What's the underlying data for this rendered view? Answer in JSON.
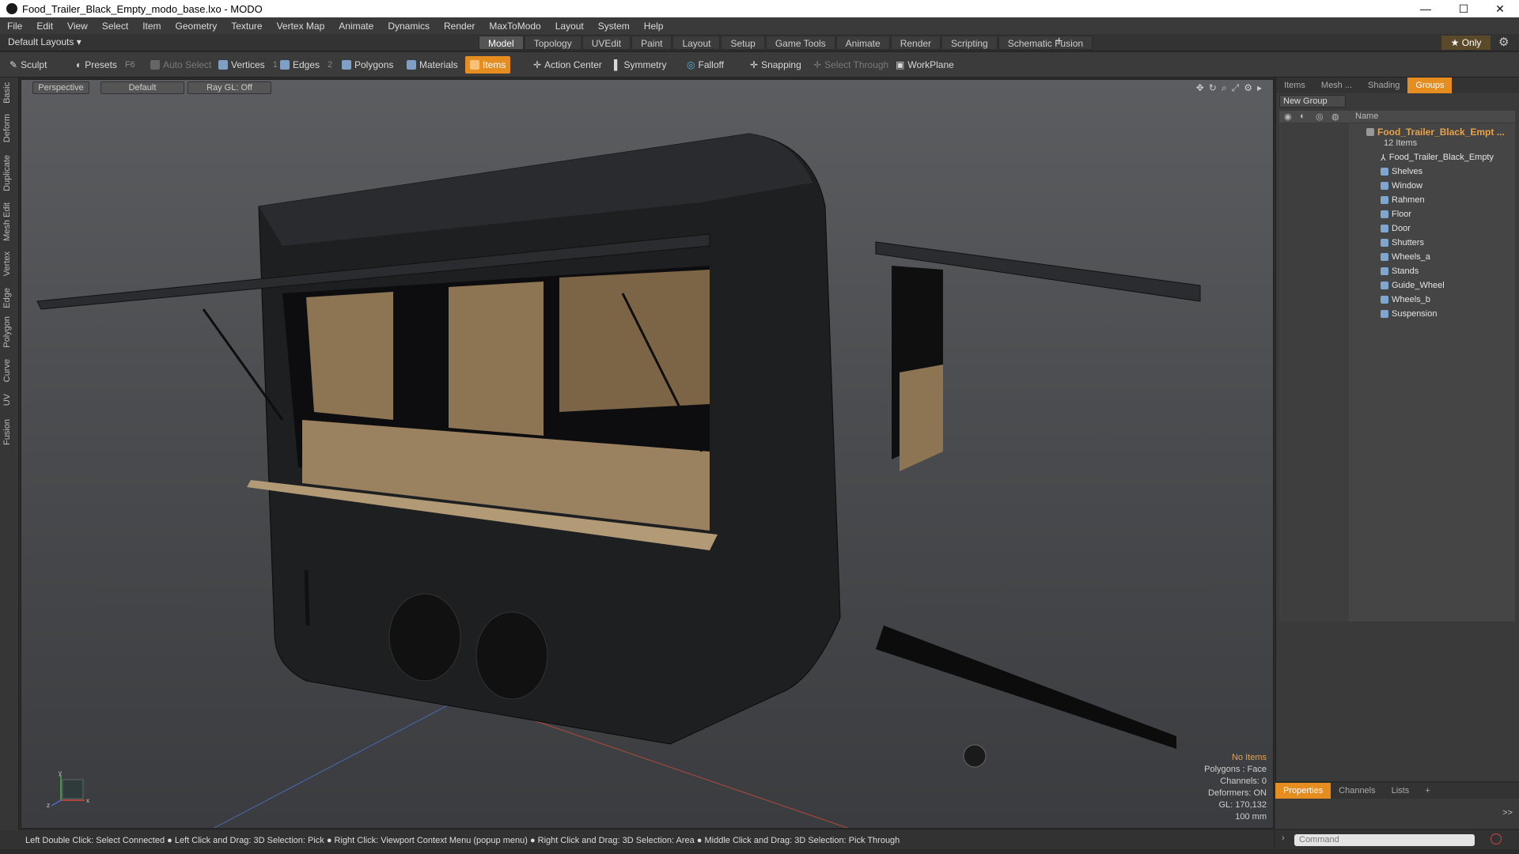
{
  "window": {
    "title": "Food_Trailer_Black_Empty_modo_base.lxo - MODO",
    "min": "—",
    "max": "☐",
    "close": "✕"
  },
  "menu": [
    "File",
    "Edit",
    "View",
    "Select",
    "Item",
    "Geometry",
    "Texture",
    "Vertex Map",
    "Animate",
    "Dynamics",
    "Render",
    "MaxToModo",
    "Layout",
    "System",
    "Help"
  ],
  "layouts": {
    "selector": "Default Layouts ▾",
    "tabs": [
      "Model",
      "Topology",
      "UVEdit",
      "Paint",
      "Layout",
      "Setup",
      "Game Tools",
      "Animate",
      "Render",
      "Scripting",
      "Schematic Fusion"
    ],
    "plus": "+",
    "only": "★ Only"
  },
  "toolbar": {
    "sculpt": "Sculpt",
    "presets": "Presets",
    "presets_key": "F6",
    "auto_select": "Auto Select",
    "vertices": "Vertices",
    "vertices_count": "1",
    "edges": "Edges",
    "edges_count": "2",
    "polygons": "Polygons",
    "materials": "Materials",
    "items": "Items",
    "action_center": "Action Center",
    "symmetry": "Symmetry",
    "falloff": "Falloff",
    "snapping": "Snapping",
    "select_through": "Select Through",
    "workplane": "WorkPlane"
  },
  "left_tabs": [
    "Basic",
    "Deform",
    "Duplicate",
    "Mesh Edit",
    "Vertex",
    "Edge",
    "Polygon",
    "Curve",
    "UV",
    "Fusion"
  ],
  "viewport": {
    "view": "Perspective",
    "shading": "Default",
    "raygl": "Ray GL: Off",
    "stats": {
      "sel": "No Items",
      "polygons": "Polygons : Face",
      "channels": "Channels: 0",
      "deformers": "Deformers: ON",
      "gl": "GL: 170,132",
      "scale": "100 mm"
    },
    "axis": {
      "x": "x",
      "y": "y",
      "z": "z"
    }
  },
  "right_panel": {
    "tabs": [
      "Items",
      "Mesh ...",
      "Shading",
      "Groups"
    ],
    "new_group": "New Group",
    "name_header": "Name",
    "group_name": "Food_Trailer_Black_Empt ...",
    "group_count": "12 Items",
    "items": [
      "Food_Trailer_Black_Empty",
      "Shelves",
      "Window",
      "Rahmen",
      "Floor",
      "Door",
      "Shutters",
      "Wheels_a",
      "Stands",
      "Guide_Wheel",
      "Wheels_b",
      "Suspension"
    ]
  },
  "bottom_panel": {
    "tabs": [
      "Properties",
      "Channels",
      "Lists",
      "+"
    ],
    "expand": ">>"
  },
  "status": "Left Double Click: Select Connected ● Left Click and Drag: 3D Selection: Pick ● Right Click: Viewport Context Menu (popup menu) ● Right Click and Drag: 3D Selection: Area ● Middle Click and Drag: 3D Selection: Pick Through",
  "command_placeholder": "Command"
}
